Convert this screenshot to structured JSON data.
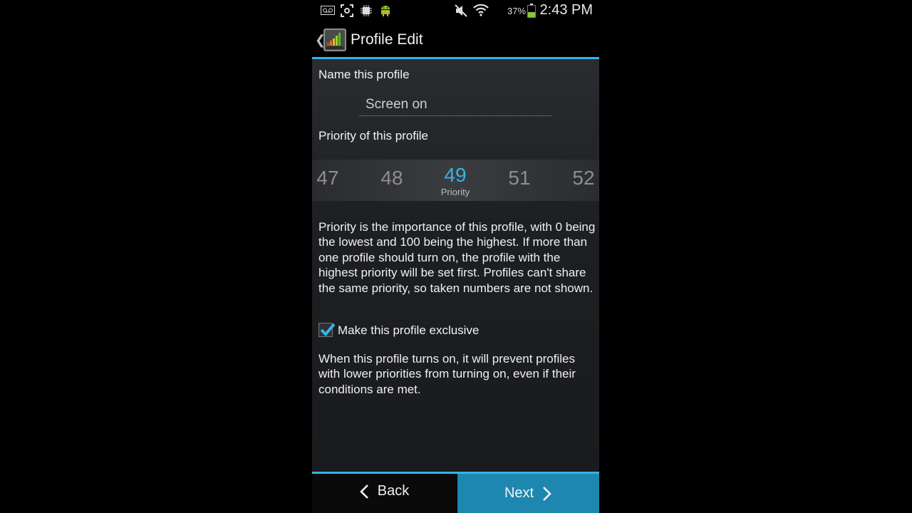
{
  "status_bar": {
    "battery_pct": "37%",
    "time": "2:43 PM",
    "icons": [
      "voicemail-icon",
      "screenshot-icon",
      "chip-icon",
      "android-icon",
      "mute-icon",
      "wifi-icon",
      "battery-icon"
    ]
  },
  "action_bar": {
    "title": "Profile Edit",
    "icon": "setcpu-app-icon"
  },
  "form": {
    "name_label": "Name this profile",
    "name_value": "Screen on",
    "priority_label": "Priority of this profile",
    "priority_picker": {
      "values": [
        "47",
        "48",
        "49",
        "51",
        "52"
      ],
      "selected": "49",
      "selected_sublabel": "Priority"
    },
    "priority_help": "Priority is the importance of this profile, with 0 being the lowest and 100 being the highest. If more than one profile should turn on, the profile with the highest priority will be set first. Profiles can't share the same priority, so taken numbers are not shown.",
    "exclusive_label": "Make this profile exclusive",
    "exclusive_checked": true,
    "exclusive_help": "When this profile turns on, it will prevent profiles with lower priorities from turning on, even if their conditions are met."
  },
  "buttons": {
    "back": "Back",
    "next": "Next"
  },
  "colors": {
    "accent": "#33b5e5",
    "next_button": "#1e87b0"
  }
}
